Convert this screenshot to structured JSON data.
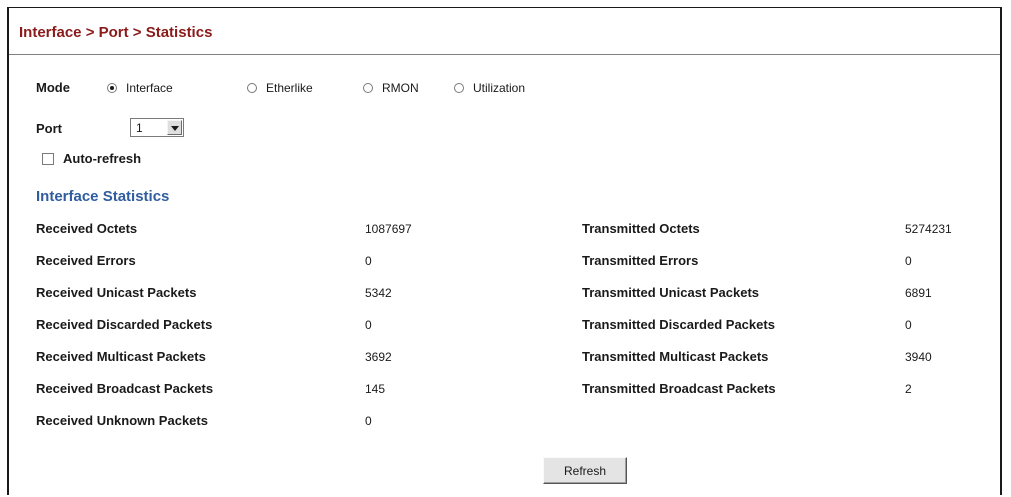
{
  "header": {
    "title": "Interface > Port > Statistics"
  },
  "form": {
    "mode_label": "Mode",
    "mode_options": [
      "Interface",
      "Etherlike",
      "RMON",
      "Utilization"
    ],
    "mode_selected": "Interface",
    "port_label": "Port",
    "port_value": "1",
    "auto_refresh_label": "Auto-refresh",
    "auto_refresh_checked": false
  },
  "stats": {
    "section_title": "Interface Statistics",
    "received": [
      {
        "label": "Received Octets",
        "value": "1087697"
      },
      {
        "label": "Received Errors",
        "value": "0"
      },
      {
        "label": "Received Unicast Packets",
        "value": "5342"
      },
      {
        "label": "Received Discarded Packets",
        "value": "0"
      },
      {
        "label": "Received Multicast Packets",
        "value": "3692"
      },
      {
        "label": "Received Broadcast Packets",
        "value": "145"
      },
      {
        "label": "Received Unknown Packets",
        "value": "0"
      }
    ],
    "transmitted": [
      {
        "label": "Transmitted Octets",
        "value": "5274231"
      },
      {
        "label": "Transmitted Errors",
        "value": "0"
      },
      {
        "label": "Transmitted Unicast Packets",
        "value": "6891"
      },
      {
        "label": "Transmitted Discarded Packets",
        "value": "0"
      },
      {
        "label": "Transmitted Multicast Packets",
        "value": "3940"
      },
      {
        "label": "Transmitted Broadcast Packets",
        "value": "2"
      }
    ]
  },
  "actions": {
    "refresh_label": "Refresh"
  }
}
